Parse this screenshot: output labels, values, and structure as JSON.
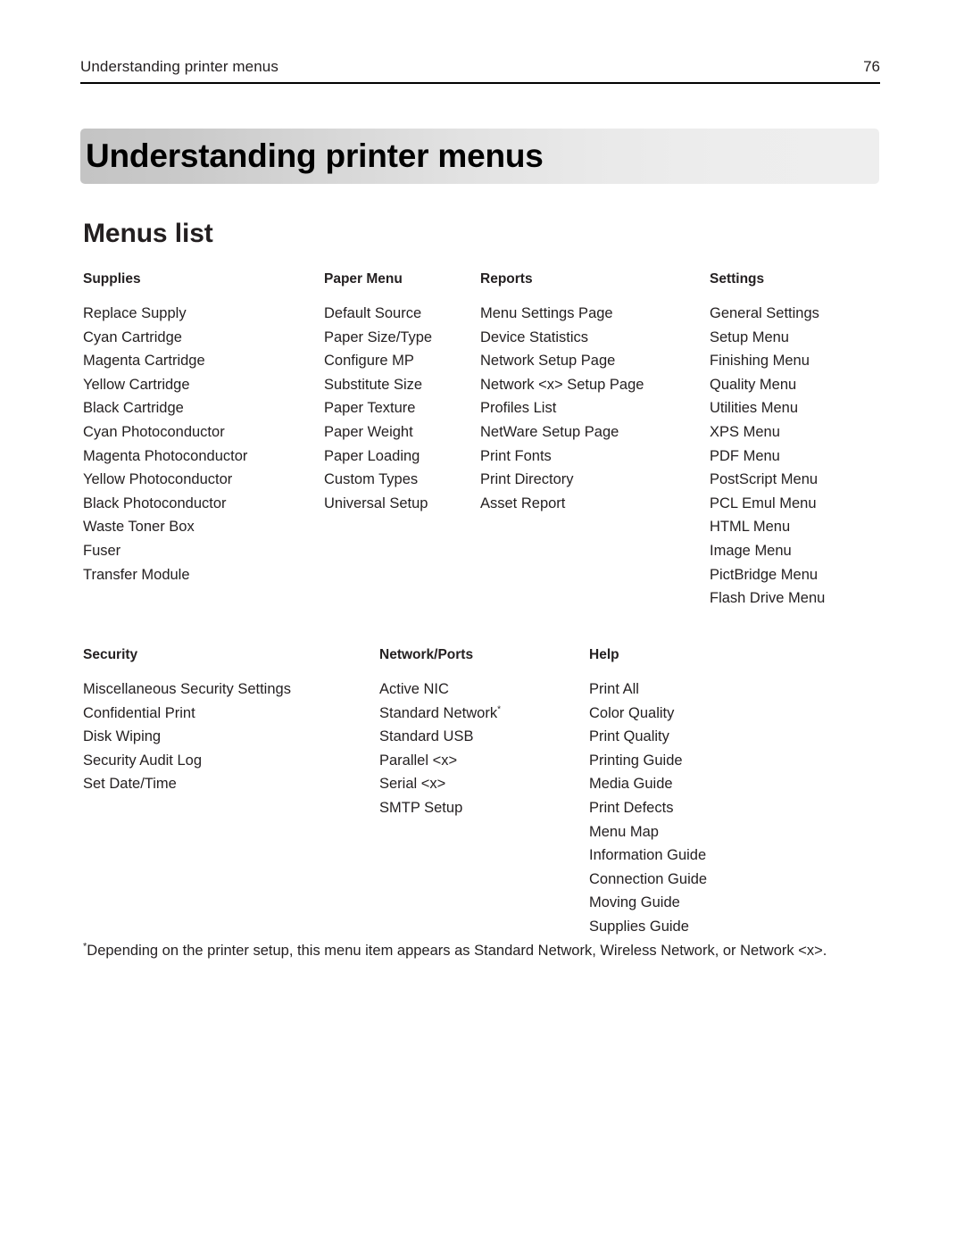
{
  "header": {
    "running_title": "Understanding printer menus",
    "page_number": "76"
  },
  "chapter": {
    "title": "Understanding printer menus"
  },
  "section": {
    "heading": "Menus list"
  },
  "tables": {
    "primary": {
      "columns": [
        {
          "heading": "Supplies",
          "items": [
            "Replace Supply",
            "Cyan Cartridge",
            "Magenta Cartridge",
            "Yellow Cartridge",
            "Black Cartridge",
            "Cyan Photoconductor",
            "Magenta Photoconductor",
            "Yellow Photoconductor",
            "Black Photoconductor",
            "Waste Toner Box",
            "Fuser",
            "Transfer Module"
          ]
        },
        {
          "heading": "Paper Menu",
          "items": [
            "Default Source",
            "Paper Size/Type",
            "Configure MP",
            "Substitute Size",
            "Paper Texture",
            "Paper Weight",
            "Paper Loading",
            "Custom Types",
            "Universal Setup"
          ]
        },
        {
          "heading": "Reports",
          "items": [
            "Menu Settings Page",
            "Device Statistics",
            "Network Setup Page",
            "Network <x> Setup Page",
            "Profiles List",
            "NetWare Setup Page",
            "Print Fonts",
            "Print Directory",
            "Asset Report"
          ]
        },
        {
          "heading": "Settings",
          "items": [
            "General Settings",
            "Setup Menu",
            "Finishing Menu",
            "Quality Menu",
            "Utilities Menu",
            "XPS Menu",
            "PDF Menu",
            "PostScript Menu",
            "PCL Emul Menu",
            "HTML Menu",
            "Image Menu",
            "PictBridge Menu",
            "Flash Drive Menu"
          ]
        }
      ]
    },
    "secondary": {
      "columns": [
        {
          "heading": "Security",
          "items": [
            "Miscellaneous Security Settings",
            "Confidential Print",
            "Disk Wiping",
            "Security Audit Log",
            "Set Date/Time"
          ]
        },
        {
          "heading": "Network/Ports",
          "items": [
            "Active NIC",
            "Standard Network",
            "Standard USB",
            "Parallel <x>",
            "Serial <x>",
            "SMTP Setup"
          ],
          "footnote_marker_on_item": "Standard Network",
          "footnote_marker": "*"
        },
        {
          "heading": "Help",
          "items": [
            "Print All",
            "Color Quality",
            "Print Quality",
            "Printing Guide",
            "Media Guide",
            "Print Defects",
            "Menu Map",
            "Information Guide",
            "Connection Guide",
            "Moving Guide",
            "Supplies Guide"
          ]
        }
      ]
    }
  },
  "footnote": {
    "marker": "*",
    "text": "Depending on the printer setup, this menu item appears as Standard Network, Wireless Network, or Network <x>."
  }
}
